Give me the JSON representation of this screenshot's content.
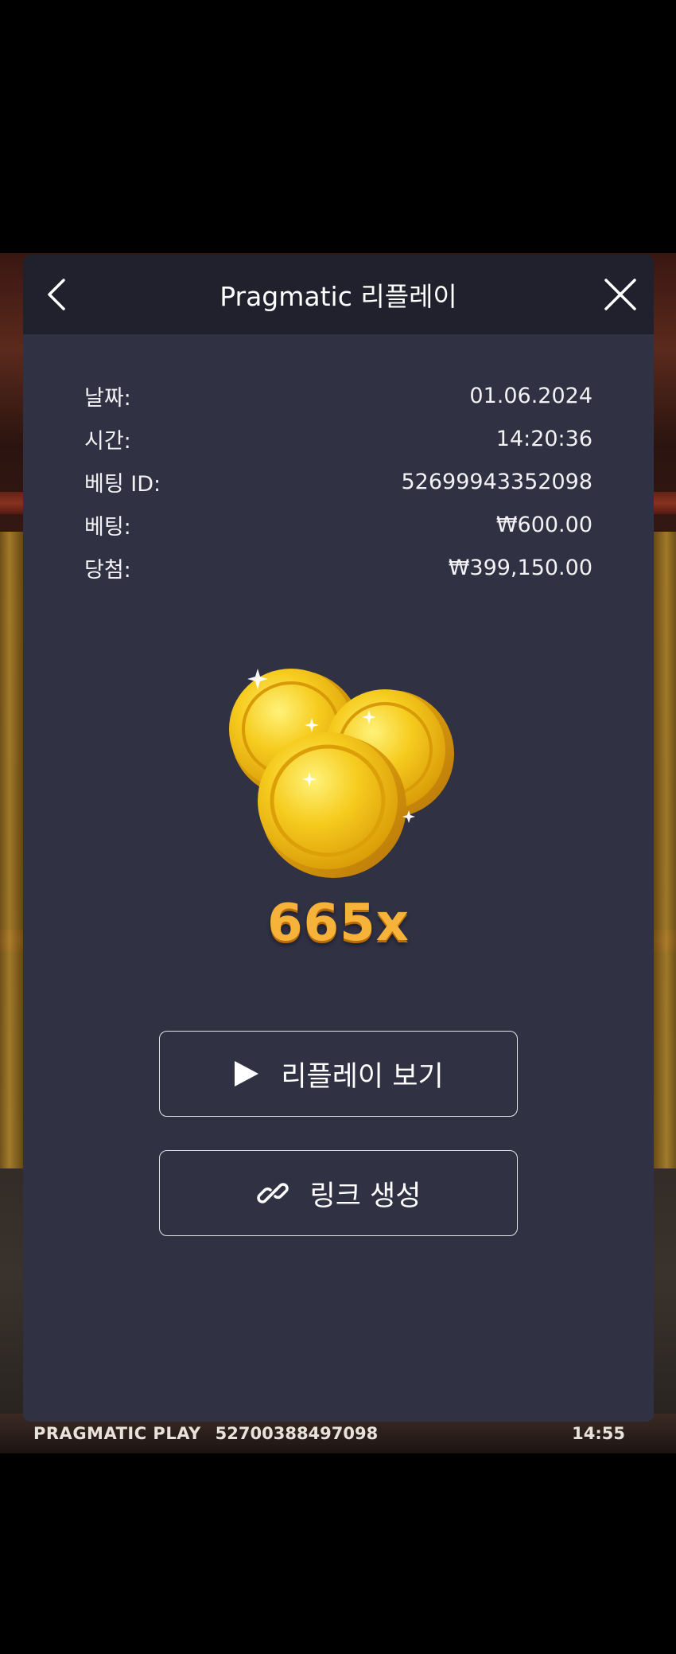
{
  "header": {
    "title": "Pragmatic 리플레이"
  },
  "bet_info": [
    {
      "label": "날짜:",
      "value": "01.06.2024"
    },
    {
      "label": "시간:",
      "value": "14:20:36"
    },
    {
      "label": "베팅 ID:",
      "value": "52699943352098"
    },
    {
      "label": "베팅:",
      "value": "₩600.00"
    },
    {
      "label": "당첨:",
      "value": "₩399,150.00"
    }
  ],
  "win_multiplier": "665x",
  "buttons": {
    "replay_label": "리플레이 보기",
    "link_label": "링크 생성"
  },
  "footer": {
    "brand": "PRAGMATIC PLAY",
    "round_id": "52700388497098",
    "clock": "14:55"
  },
  "icons": {
    "back": "chevron-left-icon",
    "close": "close-icon",
    "play": "play-icon",
    "link": "link-icon",
    "coins": "gold-coins-icon"
  },
  "colors": {
    "modal_bg": "#303143",
    "header_bg": "#20212d",
    "multiplier": "#f7b23a"
  }
}
